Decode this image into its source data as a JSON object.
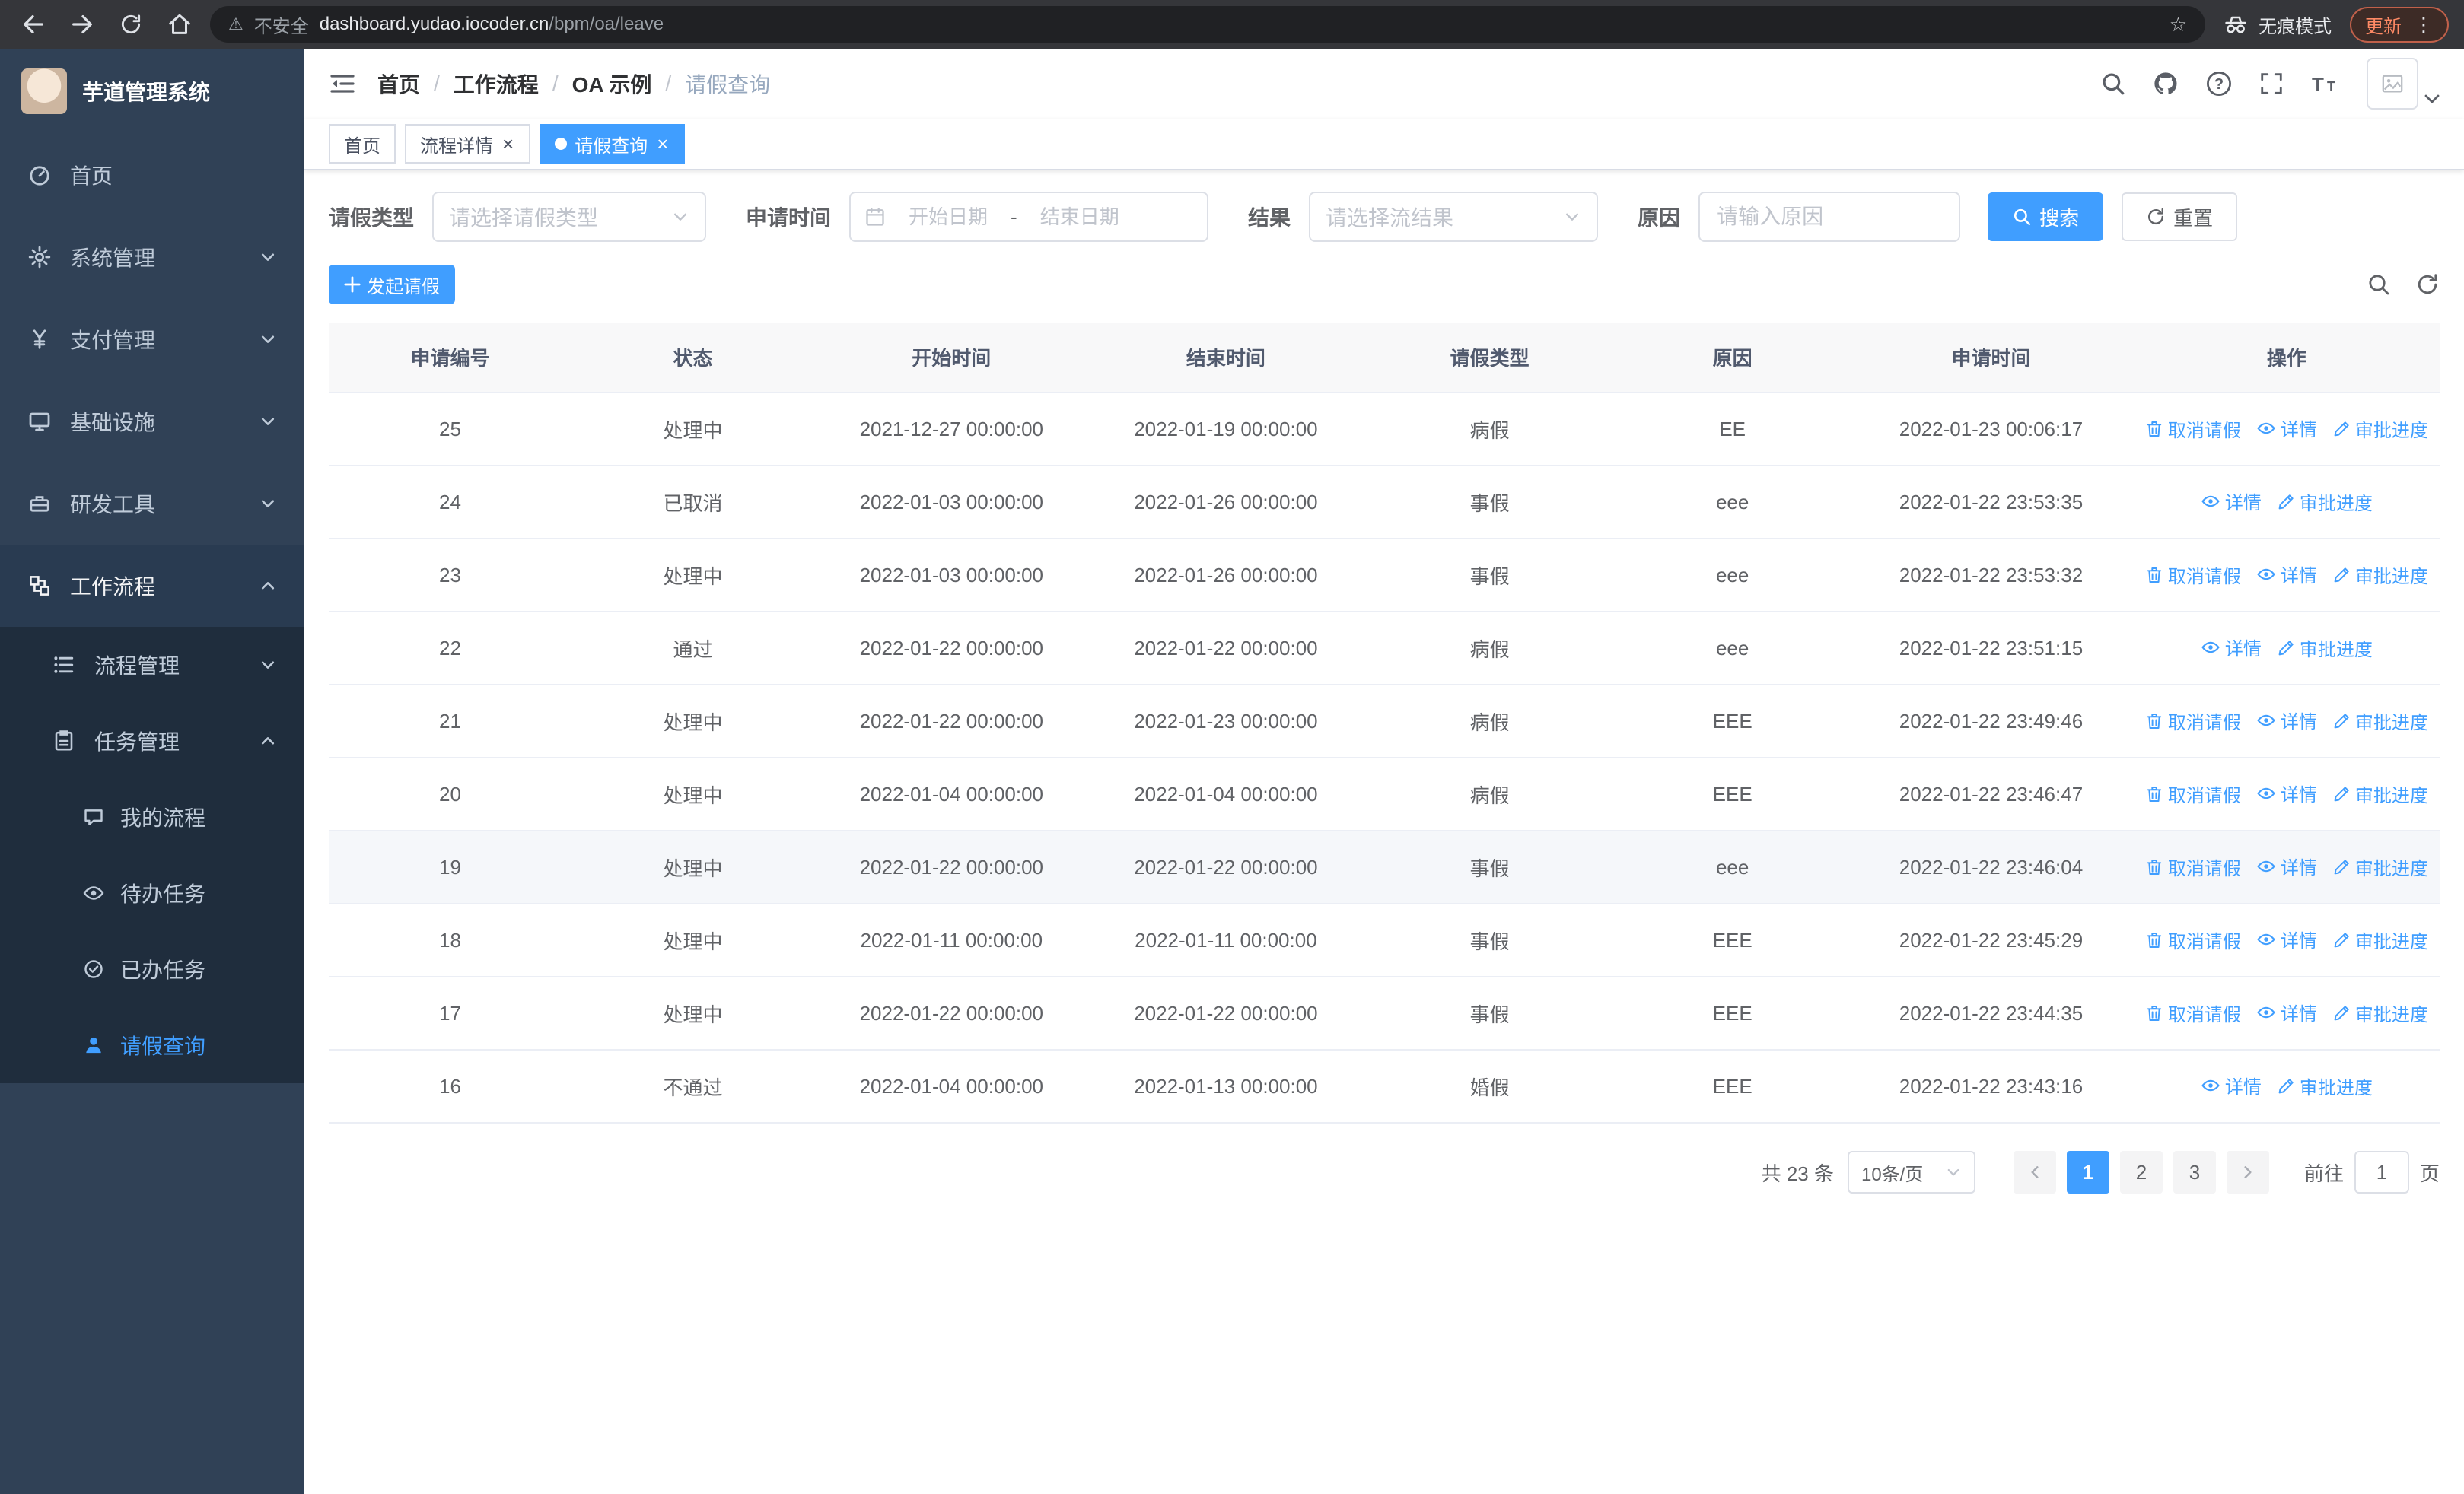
{
  "browser": {
    "security_label": "不安全",
    "url_domain": "dashboard.yudao.iocoder.cn",
    "url_path": "/bpm/oa/leave",
    "incognito_label": "无痕模式",
    "update_label": "更新"
  },
  "sidebar": {
    "logo_title": "芋道管理系统",
    "items": [
      {
        "label": "首页",
        "icon": "dashboard-icon"
      },
      {
        "label": "系统管理",
        "icon": "gear-icon"
      },
      {
        "label": "支付管理",
        "icon": "yen-icon"
      },
      {
        "label": "基础设施",
        "icon": "monitor-icon"
      },
      {
        "label": "研发工具",
        "icon": "toolbox-icon"
      },
      {
        "label": "工作流程",
        "icon": "workflow-icon",
        "expanded": true
      }
    ],
    "submenu": [
      {
        "label": "流程管理",
        "icon": "list-icon",
        "expanded": false
      },
      {
        "label": "任务管理",
        "icon": "clipboard-icon",
        "expanded": true
      }
    ],
    "task_items": [
      {
        "label": "我的流程",
        "icon": "chat-icon"
      },
      {
        "label": "待办任务",
        "icon": "eye-icon"
      },
      {
        "label": "已办任务",
        "icon": "check-circle-icon"
      },
      {
        "label": "请假查询",
        "icon": "user-icon",
        "active": true
      }
    ]
  },
  "header": {
    "breadcrumb": [
      "首页",
      "工作流程",
      "OA 示例",
      "请假查询"
    ],
    "icons": [
      "search-icon",
      "github-icon",
      "help-icon",
      "fullscreen-icon",
      "font-size-icon",
      "avatar",
      "caret-down-icon"
    ]
  },
  "tabs": [
    {
      "label": "首页",
      "closable": false,
      "active": false
    },
    {
      "label": "流程详情",
      "closable": true,
      "active": false
    },
    {
      "label": "请假查询",
      "closable": true,
      "active": true
    }
  ],
  "filters": {
    "type_label": "请假类型",
    "type_placeholder": "请选择请假类型",
    "time_label": "申请时间",
    "start_placeholder": "开始日期",
    "end_placeholder": "结束日期",
    "range_separator": "-",
    "result_label": "结果",
    "result_placeholder": "请选择流结果",
    "reason_label": "原因",
    "reason_placeholder": "请输入原因",
    "reason_value": "",
    "search_label": "搜索",
    "reset_label": "重置"
  },
  "toolbar": {
    "create_label": "发起请假",
    "icons": [
      "search-icon",
      "refresh-icon"
    ]
  },
  "table": {
    "columns": [
      "申请编号",
      "状态",
      "开始时间",
      "结束时间",
      "请假类型",
      "原因",
      "申请时间",
      "操作"
    ],
    "action_labels": {
      "cancel": "取消请假",
      "detail": "详情",
      "progress": "审批进度"
    },
    "rows": [
      {
        "id": "25",
        "status": "处理中",
        "start": "2021-12-27 00:00:00",
        "end": "2022-01-19 00:00:00",
        "type": "病假",
        "reason": "EE",
        "applied": "2022-01-23 00:06:17",
        "actions": [
          "cancel",
          "detail",
          "progress"
        ]
      },
      {
        "id": "24",
        "status": "已取消",
        "start": "2022-01-03 00:00:00",
        "end": "2022-01-26 00:00:00",
        "type": "事假",
        "reason": "eee",
        "applied": "2022-01-22 23:53:35",
        "actions": [
          "detail",
          "progress"
        ]
      },
      {
        "id": "23",
        "status": "处理中",
        "start": "2022-01-03 00:00:00",
        "end": "2022-01-26 00:00:00",
        "type": "事假",
        "reason": "eee",
        "applied": "2022-01-22 23:53:32",
        "actions": [
          "cancel",
          "detail",
          "progress"
        ]
      },
      {
        "id": "22",
        "status": "通过",
        "start": "2022-01-22 00:00:00",
        "end": "2022-01-22 00:00:00",
        "type": "病假",
        "reason": "eee",
        "applied": "2022-01-22 23:51:15",
        "actions": [
          "detail",
          "progress"
        ]
      },
      {
        "id": "21",
        "status": "处理中",
        "start": "2022-01-22 00:00:00",
        "end": "2022-01-23 00:00:00",
        "type": "病假",
        "reason": "EEE",
        "applied": "2022-01-22 23:49:46",
        "actions": [
          "cancel",
          "detail",
          "progress"
        ]
      },
      {
        "id": "20",
        "status": "处理中",
        "start": "2022-01-04 00:00:00",
        "end": "2022-01-04 00:00:00",
        "type": "病假",
        "reason": "EEE",
        "applied": "2022-01-22 23:46:47",
        "actions": [
          "cancel",
          "detail",
          "progress"
        ]
      },
      {
        "id": "19",
        "status": "处理中",
        "start": "2022-01-22 00:00:00",
        "end": "2022-01-22 00:00:00",
        "type": "事假",
        "reason": "eee",
        "applied": "2022-01-22 23:46:04",
        "actions": [
          "cancel",
          "detail",
          "progress"
        ],
        "highlighted": true
      },
      {
        "id": "18",
        "status": "处理中",
        "start": "2022-01-11 00:00:00",
        "end": "2022-01-11 00:00:00",
        "type": "事假",
        "reason": "EEE",
        "applied": "2022-01-22 23:45:29",
        "actions": [
          "cancel",
          "detail",
          "progress"
        ]
      },
      {
        "id": "17",
        "status": "处理中",
        "start": "2022-01-22 00:00:00",
        "end": "2022-01-22 00:00:00",
        "type": "事假",
        "reason": "EEE",
        "applied": "2022-01-22 23:44:35",
        "actions": [
          "cancel",
          "detail",
          "progress"
        ]
      },
      {
        "id": "16",
        "status": "不通过",
        "start": "2022-01-04 00:00:00",
        "end": "2022-01-13 00:00:00",
        "type": "婚假",
        "reason": "EEE",
        "applied": "2022-01-22 23:43:16",
        "actions": [
          "detail",
          "progress"
        ]
      }
    ]
  },
  "pagination": {
    "total_label": "共 23 条",
    "page_size": "10条/页",
    "pages": [
      "1",
      "2",
      "3"
    ],
    "active_page": "1",
    "goto_label": "前往",
    "goto_value": "1",
    "goto_suffix": "页"
  },
  "colors": {
    "accent": "#409eff",
    "sidebar_bg": "#304156",
    "submenu_bg": "#1f2d3d"
  }
}
